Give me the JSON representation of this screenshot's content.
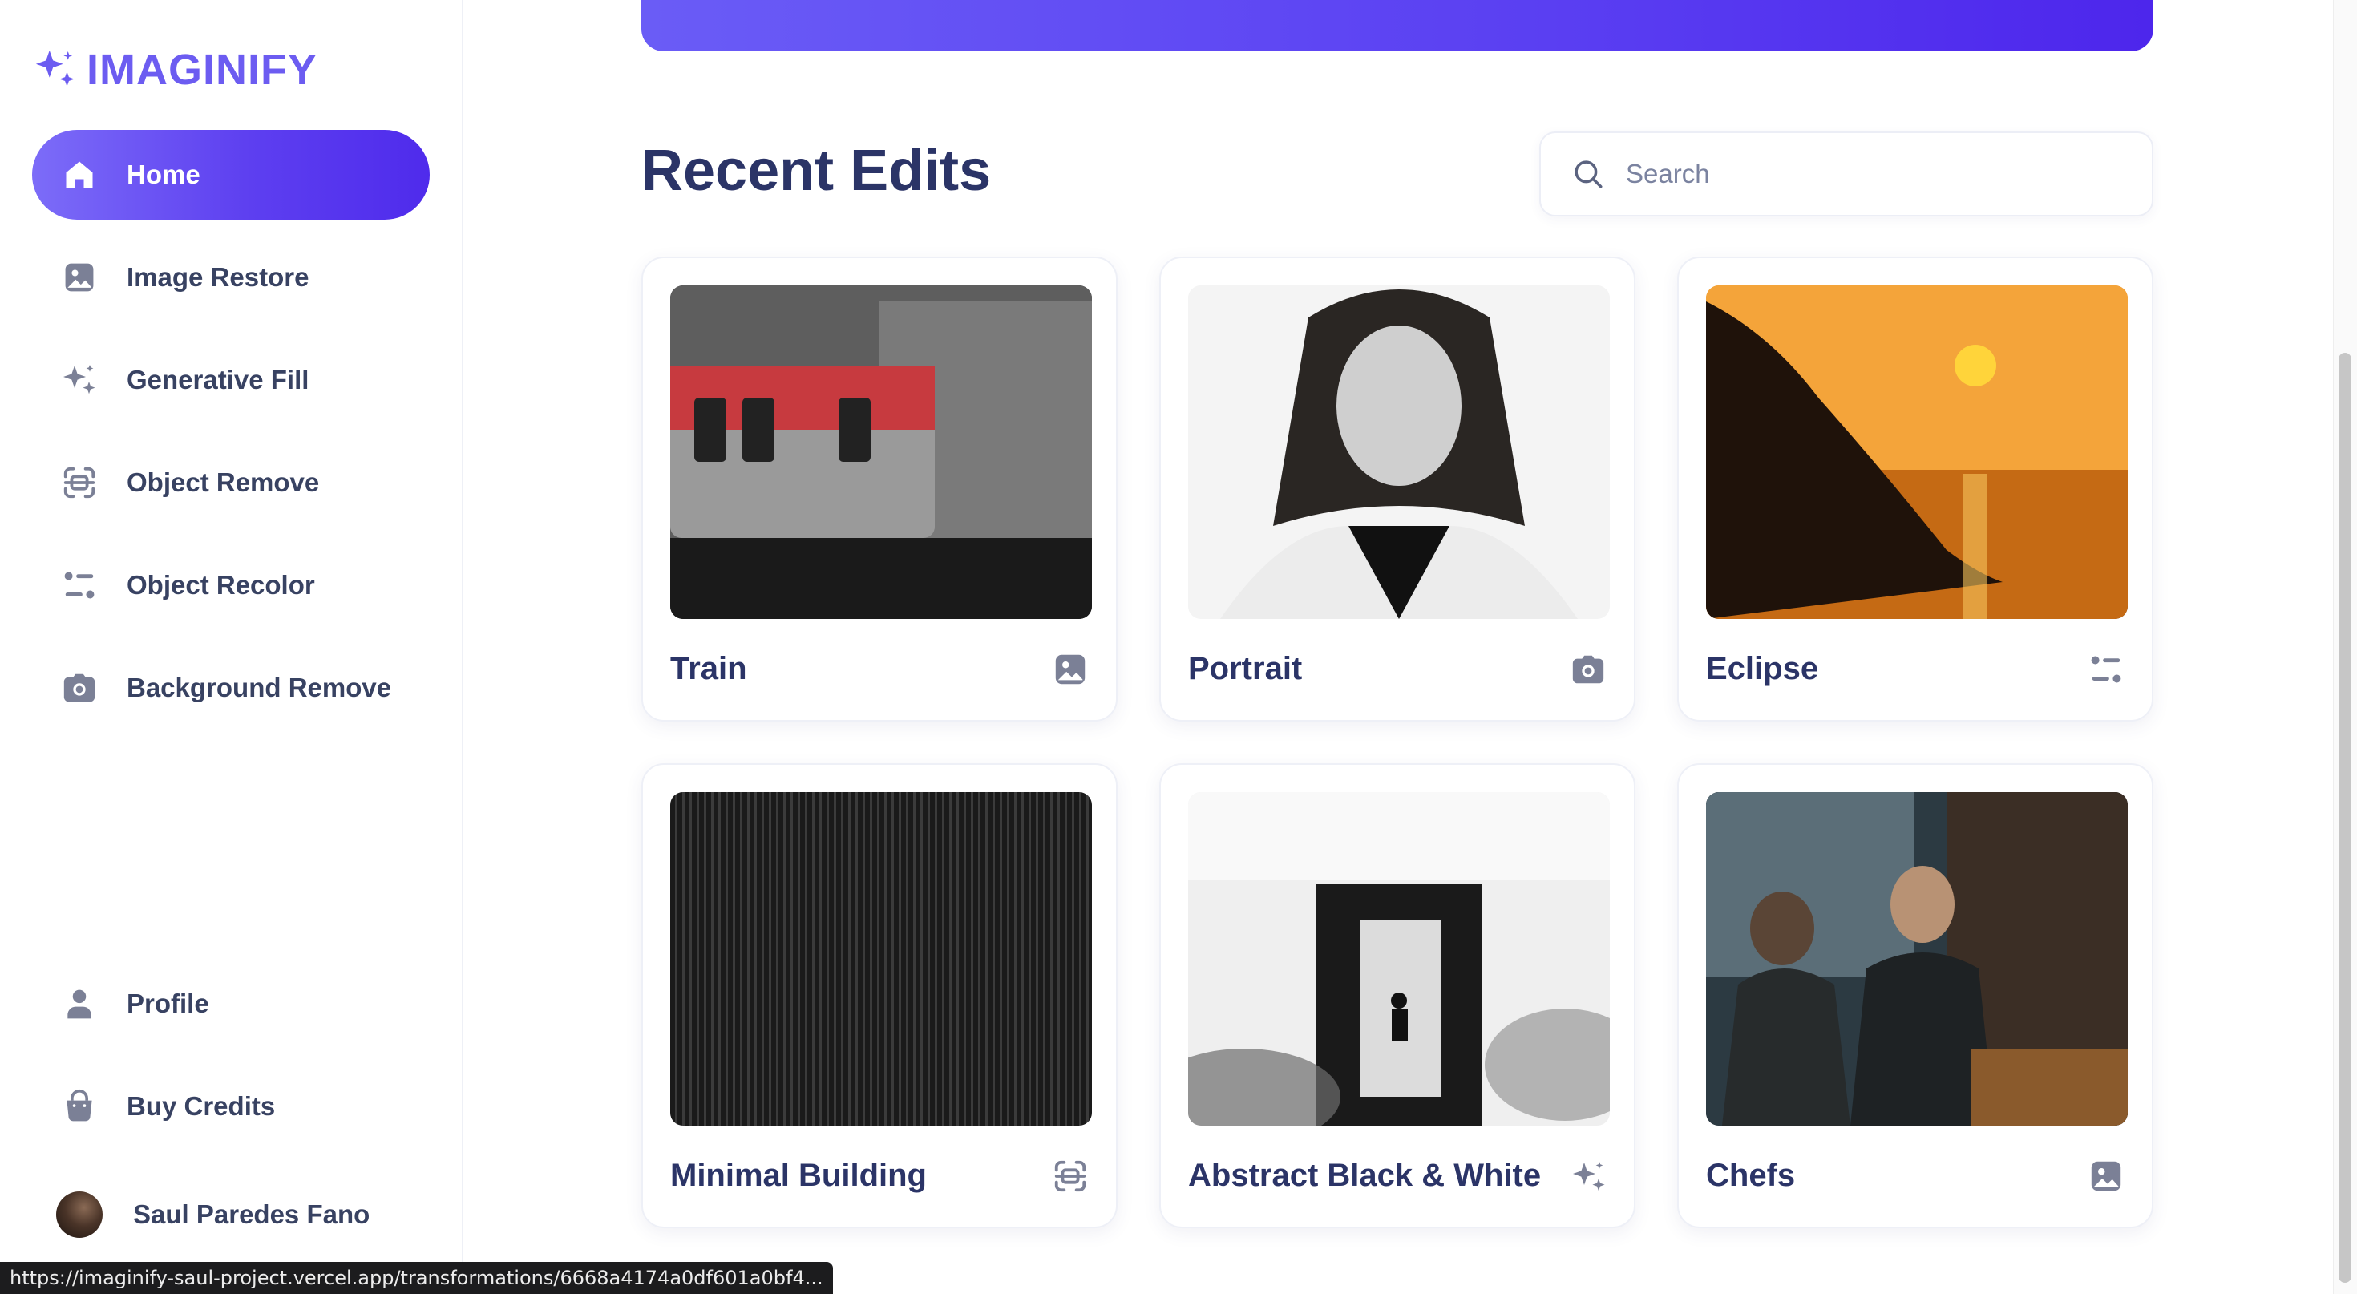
{
  "app": {
    "name": "IMAGINIFY"
  },
  "sidebar": {
    "items": [
      {
        "label": "Home",
        "icon": "home-icon",
        "active": true
      },
      {
        "label": "Image Restore",
        "icon": "image-icon"
      },
      {
        "label": "Generative Fill",
        "icon": "sparkles-icon"
      },
      {
        "label": "Object Remove",
        "icon": "scan-icon"
      },
      {
        "label": "Object Recolor",
        "icon": "filter-icon"
      },
      {
        "label": "Background Remove",
        "icon": "camera-icon"
      }
    ],
    "bottom_items": [
      {
        "label": "Profile",
        "icon": "user-icon"
      },
      {
        "label": "Buy Credits",
        "icon": "bag-icon"
      }
    ],
    "user": {
      "name": "Saul Paredes Fano"
    }
  },
  "main": {
    "section_title": "Recent Edits",
    "search": {
      "placeholder": "Search",
      "value": ""
    },
    "cards": [
      {
        "title": "Train",
        "type_icon": "image-icon"
      },
      {
        "title": "Portrait",
        "type_icon": "camera-icon"
      },
      {
        "title": "Eclipse",
        "type_icon": "filter-icon"
      },
      {
        "title": "Minimal Building",
        "type_icon": "scan-icon"
      },
      {
        "title": "Abstract Black & White",
        "type_icon": "sparkles-icon"
      },
      {
        "title": "Chefs",
        "type_icon": "image-icon"
      }
    ]
  },
  "status_bar": {
    "url": "https://imaginify-saul-project.vercel.app/transformations/6668a4174a0df601a0bf4..."
  },
  "colors": {
    "accent": "#5d3ff0",
    "text": "#384262",
    "heading": "#2b3467",
    "icon": "#7b8096"
  }
}
